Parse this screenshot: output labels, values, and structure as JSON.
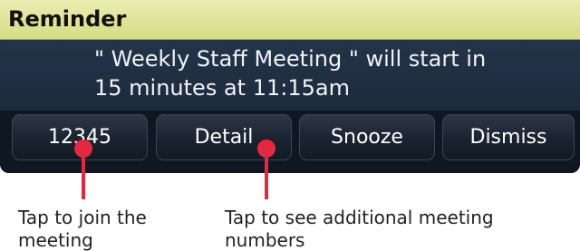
{
  "reminder": {
    "title": "Reminder",
    "message_line_1": "\" Weekly Staff Meeting \" will start in",
    "message_line_2": "15 minutes at 11:15am"
  },
  "softkeys": [
    {
      "label": "12345"
    },
    {
      "label": "Detail"
    },
    {
      "label": "Snooze"
    },
    {
      "label": "Dismiss"
    }
  ],
  "annotations": [
    {
      "line_1": "Tap to join the",
      "line_2": "meeting"
    },
    {
      "line_1": "Tap to see additional meeting",
      "line_2": "numbers"
    }
  ],
  "colors": {
    "title_bar": "#dde28f",
    "screen_background": "#1d2b3e",
    "callout": "#e4283f"
  }
}
